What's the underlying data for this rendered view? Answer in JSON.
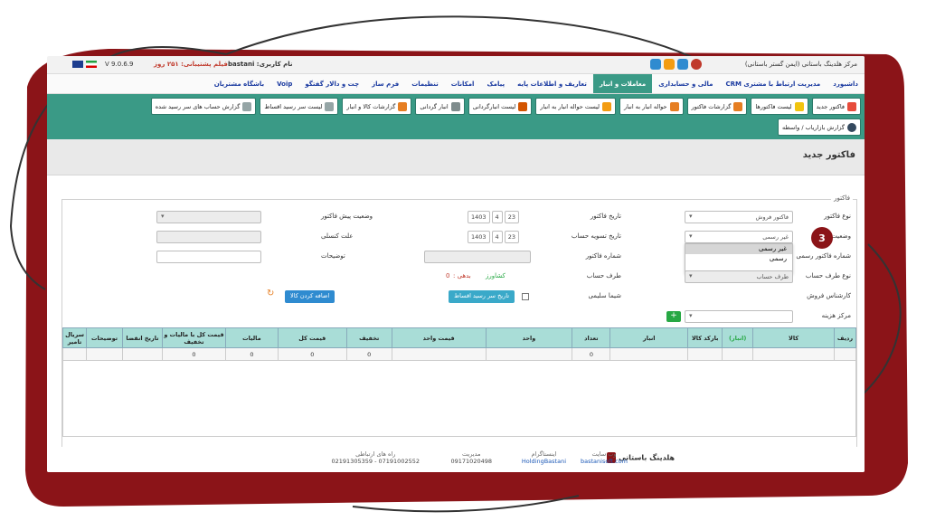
{
  "colors": {
    "frame": "#8b1418",
    "teal": "#3a9a86",
    "header_bg": "#a9ddd7",
    "accent_blue": "#2f8bd0"
  },
  "topbar": {
    "company": "مرکز هلدینگ باستانی (ایمن گستر باستانی)",
    "user": "نام کاربری: bastani",
    "support": "فیلم پشتیبانی: ۲۵۱ روز",
    "version": "V 9.0.6.9",
    "icons": [
      "notification-icon",
      "calendar-icon",
      "chat-icon",
      "power-icon"
    ]
  },
  "main_menu": [
    "داشبورد",
    "مدیریت ارتباط با مشتری CRM",
    "مالی و حسابداری",
    "معاملات و انبار",
    "تعاریف و اطلاعات پایه",
    "پیامک",
    "امکانات",
    "تنظیمات",
    "فرم ساز",
    "چت و دالار گفتگو",
    "Voip",
    "باشگاه مشتریان"
  ],
  "toolbar_row1": [
    "فاکتور جدید",
    "لیست فاکتورها",
    "گزارشات فاکتور",
    "حواله انبار به انبار",
    "لیست حواله انبار به انبار",
    "لیست انبارگردانی",
    "انبار گردانی",
    "گزارشات کالا و انبار",
    "لیست سر رسید اقساط",
    "گزارش حساب های سر رسید شده"
  ],
  "toolbar_row2": [
    "گزارش بازاریاب / واسطه"
  ],
  "page_title": "فاکتور جدید",
  "fieldset_legend": "فاکتور",
  "form": {
    "labels": {
      "invoice_type": "نوع فاکتور",
      "tax_status": "وضعیت مالیاتی",
      "official_number": "شماره فاکتور رسمی",
      "party_type": "نوع طرف حساب",
      "sales_expert": "کارشناس فروش",
      "cost_center": "مرکز هزینه",
      "invoice_date": "تاریخ فاکتور",
      "settle_date": "تاریخ تسویه حساب",
      "invoice_number": "شماره فاکتور",
      "party": "طرف حساب",
      "sales_expert_value": "شیما سلیمی",
      "pre_invoice_status": "وضعیت پیش فاکتور",
      "cancel_reason": "علت کنسلی",
      "description": "توضیحات"
    },
    "invoice_type_value": "فاکتور فروش",
    "tax_status_value": "غیر رسمی",
    "tax_options": [
      "غیر رسمی",
      "رسمی"
    ],
    "party_placeholder": "طرف حساب",
    "date_day": "23",
    "date_month": "4",
    "date_year": "1403",
    "party_info": "کشاورز",
    "debt_label": "بدهی :",
    "debt_value": "0",
    "installment_btn": "تاریخ سر رسید اقساط",
    "add_gift_btn": "اضافه کردن کالا",
    "green_btn": "+",
    "step_marker": "3"
  },
  "table": {
    "headers": [
      "ردیف",
      "کالا",
      "(انبار)",
      "بارکد کالا",
      "انبار",
      "تعداد",
      "واحد",
      "قیمت واحد",
      "تخفیف",
      "قیمت کل",
      "مالیات",
      "قیمت کل با مالیات و تخفیف",
      "تاریخ انقضا",
      "توضیحات",
      "سریال تامیر"
    ],
    "totals": [
      "0",
      "0",
      "0",
      "0",
      "0"
    ]
  },
  "footer": {
    "brand": "هلدینگ باستانی",
    "website_label": "وب سایت",
    "website": "bastanisoft.com",
    "instagram_label": "اینستاگرام",
    "instagram": "HoldingBastani",
    "management_label": "مدیریت",
    "management": "09171020498",
    "contact_label": "راه های ارتباطی",
    "contact": "07191002552 - 02191305359"
  }
}
